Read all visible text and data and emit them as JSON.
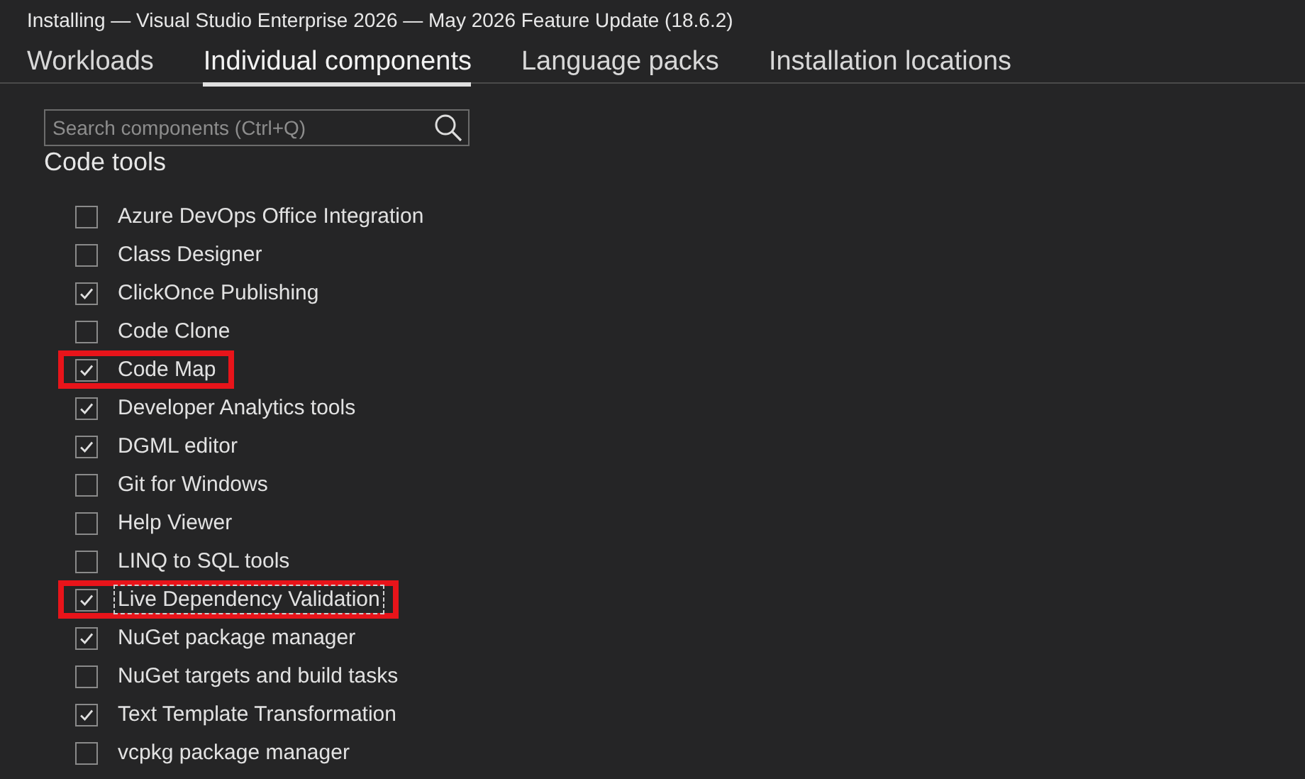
{
  "window": {
    "title": "Installing — Visual Studio Enterprise 2026 — May 2026 Feature Update (18.6.2)"
  },
  "tabs": [
    {
      "label": "Workloads",
      "selected": false
    },
    {
      "label": "Individual components",
      "selected": true
    },
    {
      "label": "Language packs",
      "selected": false
    },
    {
      "label": "Installation locations",
      "selected": false
    }
  ],
  "search": {
    "placeholder": "Search components (Ctrl+Q)"
  },
  "section": {
    "heading": "Code tools"
  },
  "components": [
    {
      "label": "Azure DevOps Office Integration",
      "checked": false,
      "highlighted": false,
      "focused": false
    },
    {
      "label": "Class Designer",
      "checked": false,
      "highlighted": false,
      "focused": false
    },
    {
      "label": "ClickOnce Publishing",
      "checked": true,
      "highlighted": false,
      "focused": false
    },
    {
      "label": "Code Clone",
      "checked": false,
      "highlighted": false,
      "focused": false
    },
    {
      "label": "Code Map",
      "checked": true,
      "highlighted": true,
      "focused": false
    },
    {
      "label": "Developer Analytics tools",
      "checked": true,
      "highlighted": false,
      "focused": false
    },
    {
      "label": "DGML editor",
      "checked": true,
      "highlighted": false,
      "focused": false
    },
    {
      "label": "Git for Windows",
      "checked": false,
      "highlighted": false,
      "focused": false
    },
    {
      "label": "Help Viewer",
      "checked": false,
      "highlighted": false,
      "focused": false
    },
    {
      "label": "LINQ to SQL tools",
      "checked": false,
      "highlighted": false,
      "focused": false
    },
    {
      "label": "Live Dependency Validation",
      "checked": true,
      "highlighted": true,
      "focused": true
    },
    {
      "label": "NuGet package manager",
      "checked": true,
      "highlighted": false,
      "focused": false
    },
    {
      "label": "NuGet targets and build tasks",
      "checked": false,
      "highlighted": false,
      "focused": false
    },
    {
      "label": "Text Template Transformation",
      "checked": true,
      "highlighted": false,
      "focused": false
    },
    {
      "label": "vcpkg package manager",
      "checked": false,
      "highlighted": false,
      "focused": false
    }
  ]
}
